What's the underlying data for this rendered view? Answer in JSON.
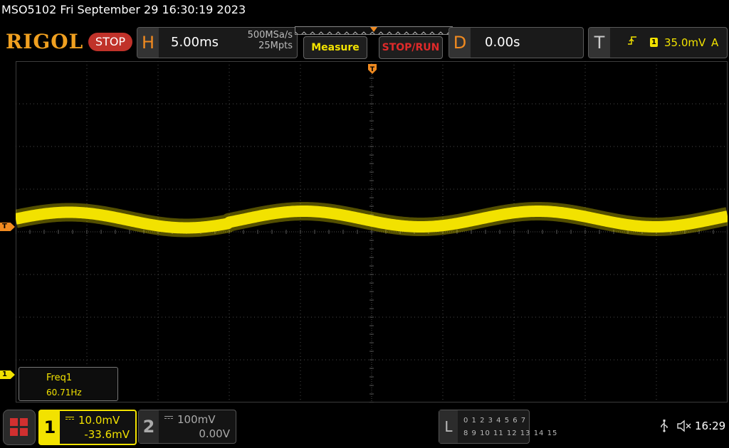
{
  "title_line": "MSO5102  Fri September 29 16:30:19 2023",
  "brand": {
    "logo": "RIGOL",
    "run_state": "STOP",
    "accent_color": "#f0a020"
  },
  "horizontal": {
    "letter": "H",
    "timebase": "5.00ms",
    "sample_rate": "500MSa/s",
    "memory_depth": "25Mpts"
  },
  "buttons": {
    "measure": "Measure",
    "stop_run": "STOP/RUN"
  },
  "delay": {
    "letter": "D",
    "value": "0.00s"
  },
  "trigger": {
    "letter": "T",
    "edge_icon": "rising-edge-icon",
    "source": "1",
    "level": "35.0mV",
    "mode": "A",
    "color": "#f08a20"
  },
  "markers": {
    "trigger_level": "T",
    "trigger_position": "T",
    "ch1_offset": "1"
  },
  "measurement": {
    "name": "Freq1",
    "value": "60.71Hz"
  },
  "channels": [
    {
      "number": "1",
      "scale": "10.0mV",
      "offset": "-33.6mV",
      "color": "#f2e200",
      "active": true
    },
    {
      "number": "2",
      "scale": "100mV",
      "offset": "0.00V",
      "color": "#9a9a9a",
      "active": false
    }
  ],
  "logic_analyzer": {
    "letter": "L",
    "row1": "0 1 2 3  4 5 6 7",
    "row2": "8 9 10 11 12 13 14 15"
  },
  "status": {
    "usb_icon": "usb-icon",
    "sound_icon": "speaker-muted-icon",
    "clock": "16:29"
  },
  "waveform": {
    "channel": "1",
    "frequency_hz": 60.71,
    "color": "#f2e200"
  }
}
